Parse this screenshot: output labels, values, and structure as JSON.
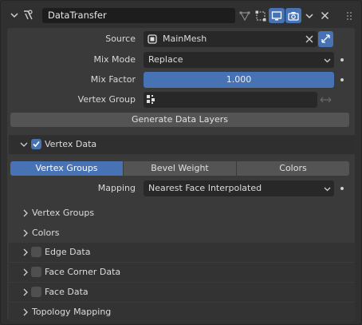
{
  "header": {
    "modifier_name": "DataTransfer"
  },
  "fields": {
    "source_label": "Source",
    "source_value": "MainMesh",
    "mix_mode_label": "Mix Mode",
    "mix_mode_value": "Replace",
    "mix_factor_label": "Mix Factor",
    "mix_factor_value": "1.000",
    "vertex_group_label": "Vertex Group",
    "vertex_group_value": ""
  },
  "generate_button": "Generate Data Layers",
  "vertex_data": {
    "title": "Vertex Data",
    "enabled": true,
    "tabs": [
      "Vertex Groups",
      "Bevel Weight",
      "Colors"
    ],
    "active_tab": 0,
    "mapping_label": "Mapping",
    "mapping_value": "Nearest Face Interpolated",
    "subpanels": [
      "Vertex Groups",
      "Colors"
    ]
  },
  "sections": [
    {
      "label": "Edge Data",
      "checkbox": true,
      "checked": false
    },
    {
      "label": "Face Corner Data",
      "checkbox": true,
      "checked": false
    },
    {
      "label": "Face Data",
      "checkbox": true,
      "checked": false
    },
    {
      "label": "Topology Mapping",
      "checkbox": false
    }
  ],
  "colors": {
    "accent": "#4772b3",
    "panel": "#303030",
    "field": "#282828"
  }
}
